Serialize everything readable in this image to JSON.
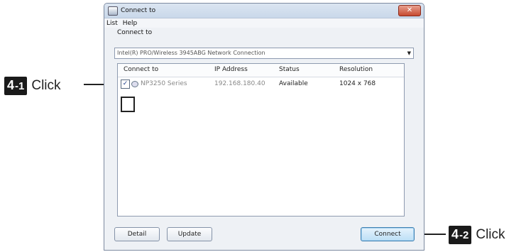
{
  "window": {
    "title": "Connect to",
    "close_label": "✕"
  },
  "menu": {
    "items": [
      "List",
      "Help"
    ]
  },
  "connect_section": {
    "label": "Connect to",
    "adapter_value": "Intel(R) PRO/Wireless 3945ABG Network Connection"
  },
  "table": {
    "columns": [
      "Connect to",
      "IP Address",
      "Status",
      "Resolution"
    ],
    "rows": [
      {
        "checked": true,
        "name": "NP3250 Series",
        "ip": "192.168.180.40",
        "status": "Available",
        "resolution": "1024 x 768"
      }
    ]
  },
  "buttons": {
    "detail": "Detail",
    "update": "Update",
    "connect": "Connect"
  },
  "callouts": {
    "c1_num": "4",
    "c1_sub": "-1",
    "c1_text": "Click",
    "c2_num": "4",
    "c2_sub": "-2",
    "c2_text": "Click"
  },
  "colors": {
    "window_bg": "#e9edf2",
    "accent_button": "#3c7fb1",
    "badge_bg": "#1a1a1a"
  }
}
